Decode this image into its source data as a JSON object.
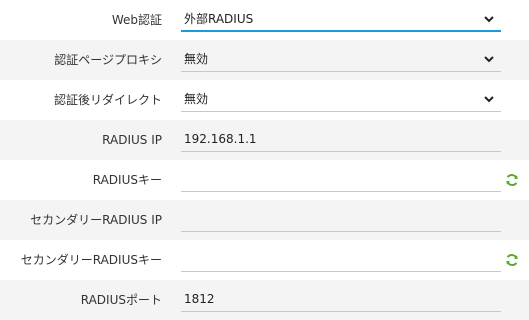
{
  "rows": [
    {
      "label": "Web認証",
      "value": "外部RADIUS"
    },
    {
      "label": "認証ページプロキシ",
      "value": "無効"
    },
    {
      "label": "認証後リダイレクト",
      "value": "無効"
    },
    {
      "label": "RADIUS IP",
      "value": "192.168.1.1"
    },
    {
      "label": "RADIUSキー",
      "value": ""
    },
    {
      "label": "セカンダリーRADIUS IP",
      "value": ""
    },
    {
      "label": "セカンダリーRADIUSキー",
      "value": ""
    },
    {
      "label": "RADIUSポート",
      "value": "1812"
    }
  ],
  "colors": {
    "accent": "#1a9bd7",
    "refresh_icon": "#58a82a"
  },
  "icons": [
    "chevron-down-icon",
    "refresh-icon"
  ]
}
